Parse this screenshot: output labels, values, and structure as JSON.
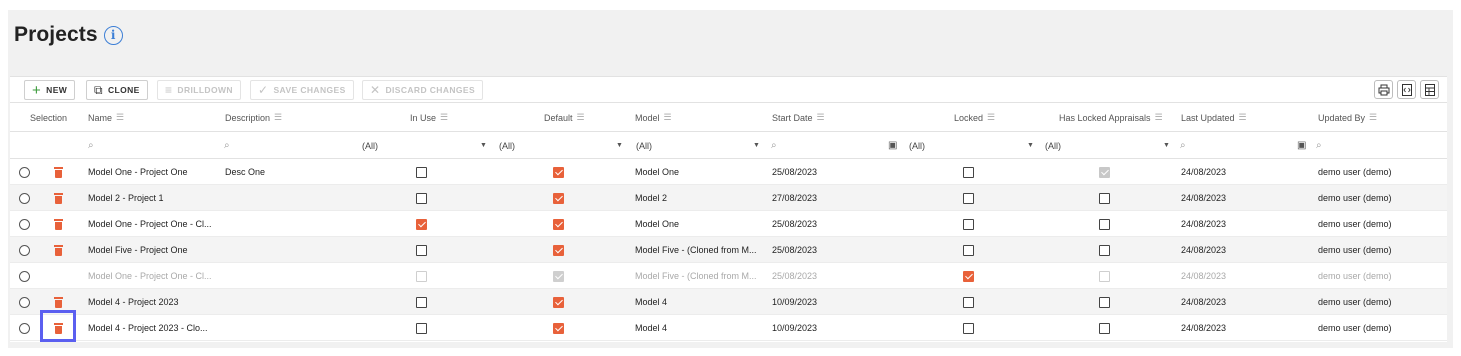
{
  "page": {
    "title": "Projects"
  },
  "toolbar": {
    "new_label": "NEW",
    "clone_label": "CLONE",
    "drilldown_label": "DRILLDOWN",
    "save_label": "SAVE CHANGES",
    "discard_label": "DISCARD CHANGES"
  },
  "columns": {
    "selection": "Selection",
    "name": "Name",
    "description": "Description",
    "in_use": "In Use",
    "default": "Default",
    "model": "Model",
    "start_date": "Start Date",
    "locked": "Locked",
    "has_locked_appraisals": "Has Locked Appraisals",
    "last_updated": "Last Updated",
    "updated_by": "Updated By"
  },
  "filters": {
    "in_use": "(All)",
    "default": "(All)",
    "model": "(All)",
    "locked": "(All)",
    "has_locked": "(All)"
  },
  "rows": [
    {
      "name": "Model One - Project One",
      "description": "Desc One",
      "model": "Model One",
      "start_date": "25/08/2023",
      "last_updated": "24/08/2023",
      "updated_by": "demo user (demo)"
    },
    {
      "name": "Model 2 - Project 1",
      "description": "",
      "model": "Model 2",
      "start_date": "27/08/2023",
      "last_updated": "24/08/2023",
      "updated_by": "demo user (demo)"
    },
    {
      "name": "Model One - Project One - Cl...",
      "description": "",
      "model": "Model One",
      "start_date": "25/08/2023",
      "last_updated": "24/08/2023",
      "updated_by": "demo user (demo)"
    },
    {
      "name": "Model Five - Project One",
      "description": "",
      "model": "Model Five - (Cloned from M...",
      "start_date": "25/08/2023",
      "last_updated": "24/08/2023",
      "updated_by": "demo user (demo)"
    },
    {
      "name": "Model One - Project One - Cl...",
      "description": "",
      "model": "Model Five - (Cloned from M...",
      "start_date": "25/08/2023",
      "last_updated": "24/08/2023",
      "updated_by": "demo user (demo)"
    },
    {
      "name": "Model 4 - Project 2023",
      "description": "",
      "model": "Model 4",
      "start_date": "10/09/2023",
      "last_updated": "24/08/2023",
      "updated_by": "demo user (demo)"
    },
    {
      "name": "Model 4 - Project 2023 - Clo...",
      "description": "",
      "model": "Model 4",
      "start_date": "10/09/2023",
      "last_updated": "24/08/2023",
      "updated_by": "demo user (demo)"
    }
  ]
}
